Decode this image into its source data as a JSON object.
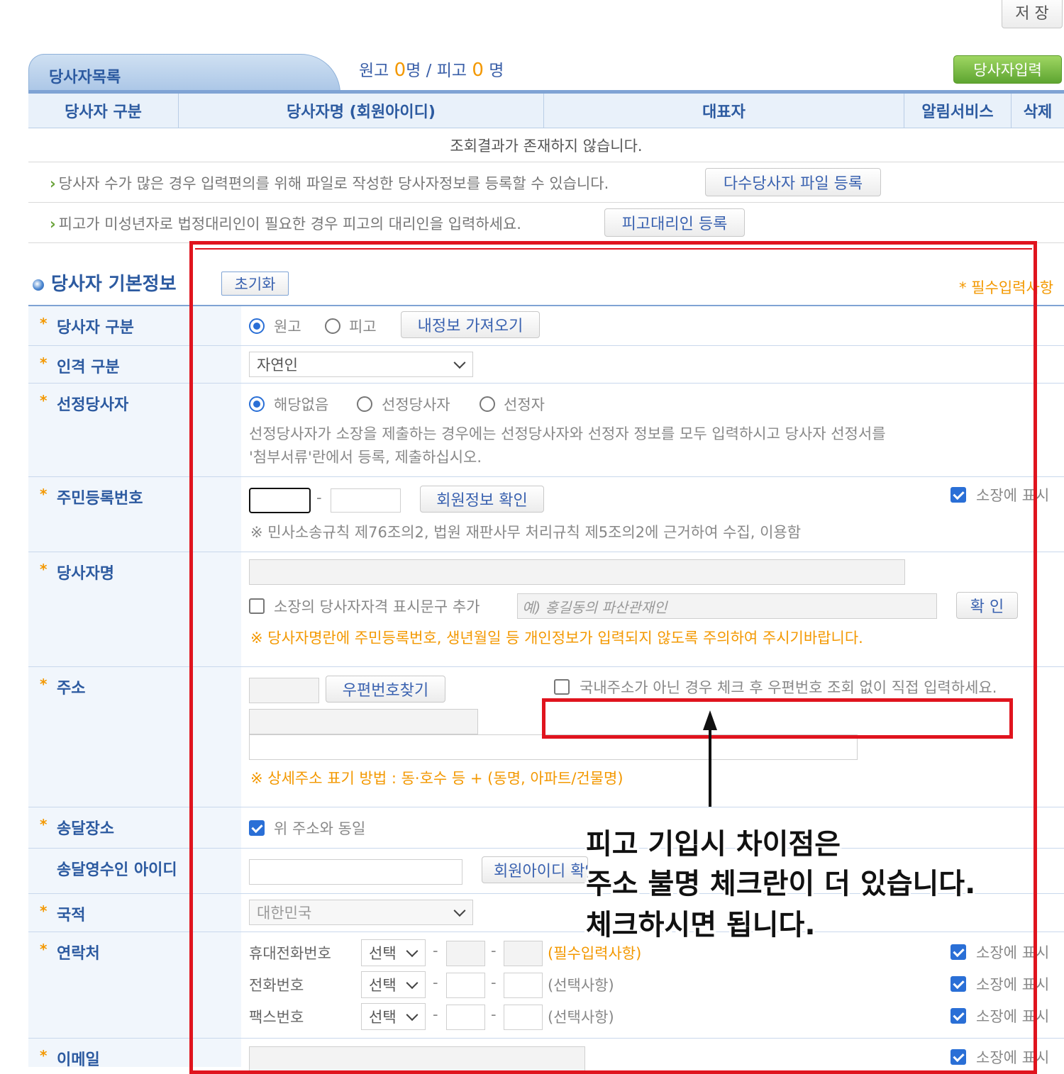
{
  "toolbar": {
    "save_label": "저 장"
  },
  "party_list": {
    "tab_label": "당사자목록",
    "plaintiff_prefix": "원고 ",
    "plaintiff_count": "0",
    "plaintiff_unit": "명 / 피고 ",
    "defendant_count": "0",
    "defendant_unit": " 명",
    "add_button": "당사자입력",
    "columns": [
      "당사자 구분",
      "당사자명 (회원아이디)",
      "대표자",
      "알림서비스",
      "삭제"
    ],
    "empty_message": "조회결과가 존재하지 않습니다."
  },
  "notices": [
    {
      "text": "당사자 수가 많은 경우 입력편의를 위해 파일로 작성한 당사자정보를 등록할 수 있습니다.",
      "button": "다수당사자 파일 등록"
    },
    {
      "text": "피고가 미성년자로 법정대리인이 필요한 경우 피고의 대리인을 입력하세요.",
      "button": "피고대리인 등록"
    }
  ],
  "basic_info": {
    "title": "당사자 기본정보",
    "reset_button": "초기화",
    "required_note": "* 필수입력사항"
  },
  "rows": {
    "party_type": {
      "label": "당사자 구분",
      "options": [
        "원고",
        "피고"
      ],
      "selected": "원고",
      "button": "내정보 가져오기"
    },
    "person_type": {
      "label": "인격 구분",
      "value": "자연인"
    },
    "designated": {
      "label": "선정당사자",
      "options": [
        "해당없음",
        "선정당사자",
        "선정자"
      ],
      "selected": "해당없음",
      "note1": "선정당사자가 소장을 제출하는 경우에는 선정당사자와 선정자 정보를 모두 입력하시고 당사자 선정서를",
      "note2": "'첨부서류'란에서 등록, 제출하십시오."
    },
    "rrn": {
      "label": "주민등록번호",
      "dash": "-",
      "button": "회원정보 확인",
      "show_label": "소장에 표시",
      "note": "※ 민사소송규칙 제76조의2, 법원 재판사무 처리규칙 제5조의2에 근거하여 수집, 이용함"
    },
    "name": {
      "label": "당사자명",
      "qual_label": "소장의 당사자자격 표시문구 추가",
      "qual_placeholder": "예) 홍길동의 파산관재인",
      "confirm_button": "확 인",
      "warning": "※ 당사자명란에 주민등록번호, 생년월일 등 개인정보가 입력되지 않도록 주의하여 주시기바랍니다."
    },
    "address": {
      "label": "주소",
      "zip_button": "우편번호찾기",
      "foreign_check": "국내주소가 아닌 경우 체크 후 우편번호 조회 없이 직접 입력하세요.",
      "note": "※ 상세주소 표기 방법 : 동·호수 등 + (동명, 아파트/건물명)"
    },
    "delivery": {
      "label": "송달장소",
      "same_label": "위 주소와 동일",
      "checked": true
    },
    "recipient": {
      "label": "송달영수인 아이디",
      "button": "회원아이디 확인"
    },
    "nationality": {
      "label": "국적",
      "value": "대한민국"
    },
    "contact": {
      "label": "연락처",
      "lines": [
        {
          "name": "휴대전화번호",
          "select": "선택",
          "note": "(필수입력사항)",
          "show": "소장에 표시"
        },
        {
          "name": "전화번호",
          "select": "선택",
          "note": "(선택사항)",
          "show": "소장에 표시"
        },
        {
          "name": "팩스번호",
          "select": "선택",
          "note": "(선택사항)",
          "show": "소장에 표시"
        }
      ]
    },
    "email": {
      "label": "이메일",
      "show": "소장에 표시"
    }
  },
  "annotation": {
    "line1": "피고 기입시 차이점은",
    "line2": "주소 불명 체크란이 더 있습니다.",
    "line3": "체크하시면 됩니다."
  },
  "colors": {
    "accent": "#2c5aa0",
    "orange": "#f39800",
    "highlight_red": "#e0141e",
    "green_button": "#6ab23a"
  }
}
